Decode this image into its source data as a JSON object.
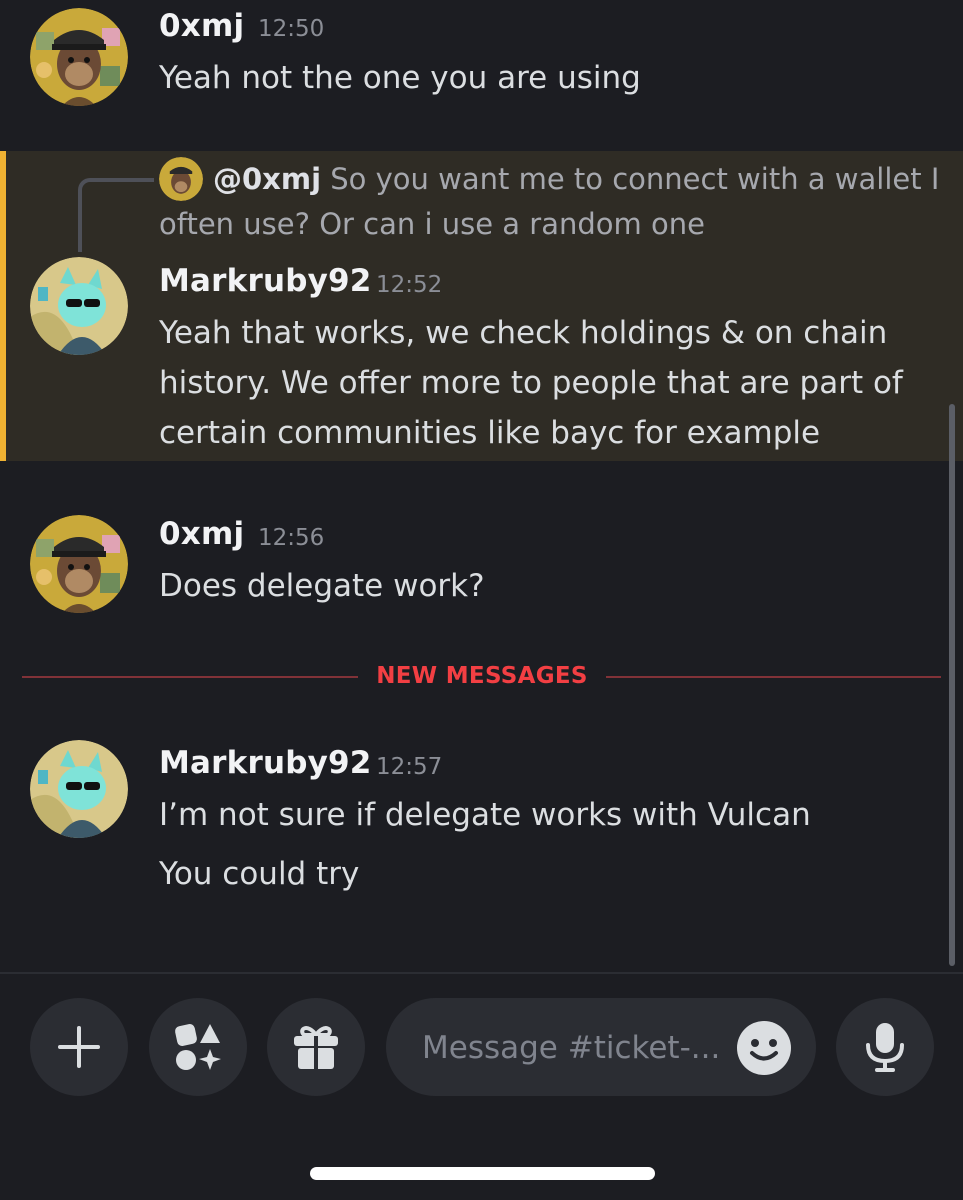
{
  "messages": [
    {
      "author": "0xmj",
      "time": "12:50",
      "lines": [
        "Yeah not the one you are using"
      ]
    },
    {
      "reply": {
        "mention": "@0xmj",
        "text": "So you want me to connect with a wallet I often use? Or can i use a random one"
      },
      "author": "Markruby92",
      "time": "12:52",
      "lines": [
        "Yeah that works, we check holdings & on chain history. We offer more to people that are part of certain communities like bayc for example"
      ]
    },
    {
      "author": "0xmj",
      "time": "12:56",
      "lines": [
        "Does delegate work?"
      ]
    },
    {
      "author": "Markruby92",
      "time": "12:57",
      "lines": [
        "I’m not sure if delegate works with Vulcan",
        "You could try"
      ]
    }
  ],
  "divider": {
    "label": "NEW MESSAGES"
  },
  "composer": {
    "placeholder": "Message #ticket-..."
  },
  "icons": {
    "add": "plus-icon",
    "apps": "apps-icon",
    "gift": "gift-icon",
    "emoji": "emoji-icon",
    "mic": "microphone-icon"
  },
  "colors": {
    "background": "#1c1d22",
    "highlight": "#2f2c25",
    "highlight_bar": "#f0b232",
    "new_messages": "#f23f43"
  }
}
